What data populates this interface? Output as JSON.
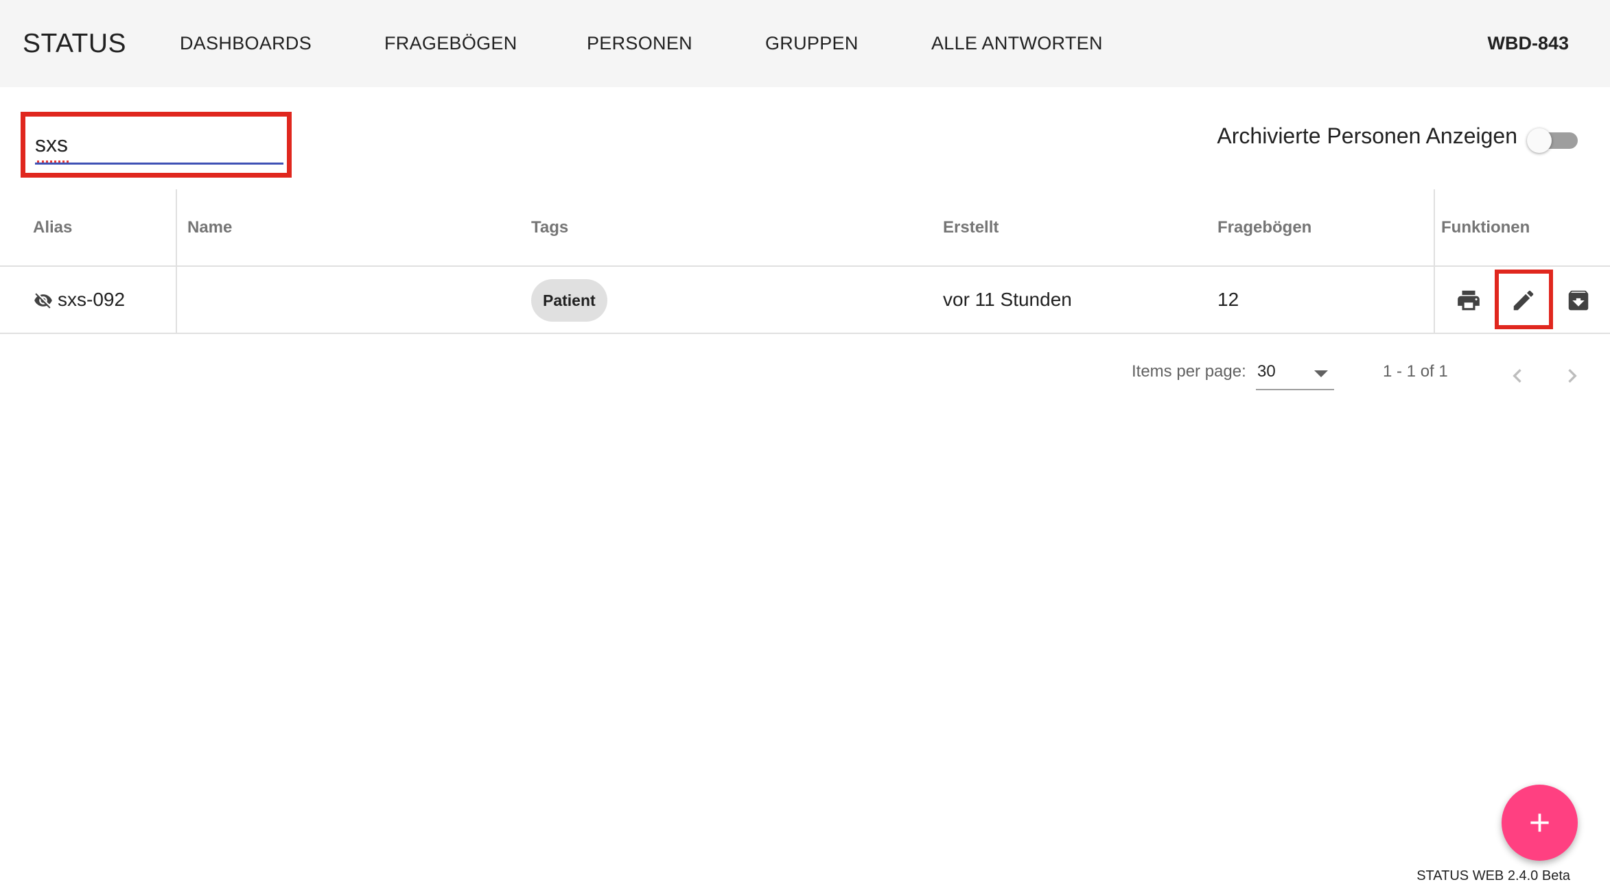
{
  "app": {
    "brand": "STATUS",
    "user_id": "WBD-843",
    "version": "STATUS WEB 2.4.0 Beta"
  },
  "nav": {
    "items": [
      {
        "label": "DASHBOARDS"
      },
      {
        "label": "FRAGEBÖGEN"
      },
      {
        "label": "PERSONEN"
      },
      {
        "label": "GRUPPEN"
      },
      {
        "label": "ALLE ANTWORTEN"
      }
    ]
  },
  "search": {
    "value": "sxs",
    "placeholder": ""
  },
  "archive_toggle": {
    "label": "Archivierte Personen Anzeigen",
    "checked": false
  },
  "table": {
    "columns": [
      "Alias",
      "Name",
      "Tags",
      "Erstellt",
      "Fragebögen",
      "Funktionen"
    ],
    "rows": [
      {
        "alias": "sxs-092",
        "alias_icon": "visibility-off-icon",
        "name": "",
        "tag": "Patient",
        "created": "vor 11 Stunden",
        "questionnaires": "12",
        "functions": [
          "print-icon",
          "edit-icon",
          "archive-icon"
        ]
      }
    ]
  },
  "paginator": {
    "label": "Items per page:",
    "page_size": "30",
    "range": "1 - 1 of 1"
  },
  "colors": {
    "accent": "#ff4081",
    "primary": "#3f51b5",
    "highlight": "#e0271e",
    "topbar": "#f5f5f5"
  }
}
